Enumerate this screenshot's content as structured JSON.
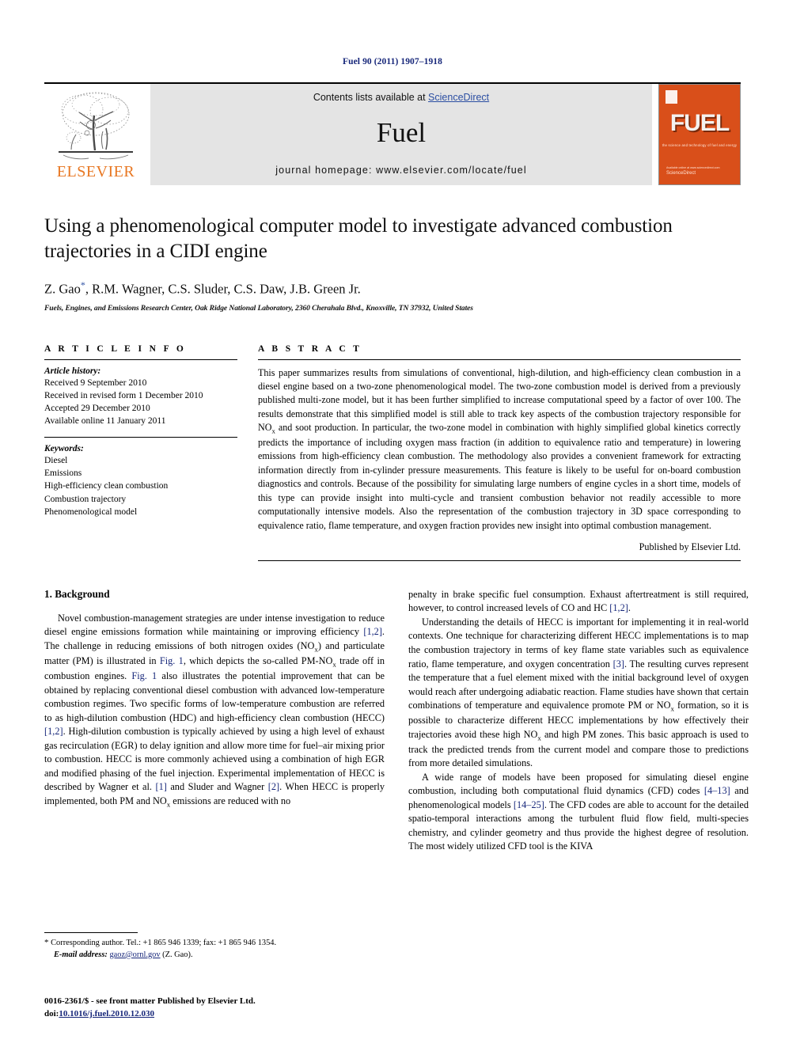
{
  "running_head": "Fuel 90 (2011) 1907–1918",
  "masthead": {
    "elsevier_wordmark": "ELSEVIER",
    "contents_prefix": "Contents lists available at ",
    "sciencedirect": "ScienceDirect",
    "journal_name": "Fuel",
    "homepage": "journal homepage: www.elsevier.com/locate/fuel",
    "cover": {
      "title": "FUEL",
      "subtitle": "the science and technology of fuel and energy",
      "footer_line1": "Available online at www.sciencedirect.com",
      "footer_line2": "ScienceDirect"
    }
  },
  "article": {
    "title": "Using a phenomenological computer model to investigate advanced combustion trajectories in a CIDI engine",
    "authors": "Z. Gao",
    "authors_rest": ", R.M. Wagner, C.S. Sluder, C.S. Daw, J.B. Green Jr.",
    "corresponding_marker": "*",
    "affiliation": "Fuels, Engines, and Emissions Research Center, Oak Ridge National Laboratory, 2360 Cherahala Blvd., Knoxville, TN 37932, United States"
  },
  "article_info": {
    "heading": "A R T I C L E    I N F O",
    "history_label": "Article history:",
    "history": [
      "Received 9 September 2010",
      "Received in revised form 1 December 2010",
      "Accepted 29 December 2010",
      "Available online 11 January 2011"
    ],
    "keywords_label": "Keywords:",
    "keywords": [
      "Diesel",
      "Emissions",
      "High-efficiency clean combustion",
      "Combustion trajectory",
      "Phenomenological model"
    ]
  },
  "abstract": {
    "heading": "A B S T R A C T",
    "text": "This paper summarizes results from simulations of conventional, high-dilution, and high-efficiency clean combustion in a diesel engine based on a two-zone phenomenological model. The two-zone combustion model is derived from a previously published multi-zone model, but it has been further simplified to increase computational speed by a factor of over 100. The results demonstrate that this simplified model is still able to track key aspects of the combustion trajectory responsible for NOx and soot production. In particular, the two-zone model in combination with highly simplified global kinetics correctly predicts the importance of including oxygen mass fraction (in addition to equivalence ratio and temperature) in lowering emissions from high-efficiency clean combustion. The methodology also provides a convenient framework for extracting information directly from in-cylinder pressure measurements. This feature is likely to be useful for on-board combustion diagnostics and controls. Because of the possibility for simulating large numbers of engine cycles in a short time, models of this type can provide insight into multi-cycle and transient combustion behavior not readily accessible to more computationally intensive models. Also the representation of the combustion trajectory in 3D space corresponding to equivalence ratio, flame temperature, and oxygen fraction provides new insight into optimal combustion management.",
    "publisher": "Published by Elsevier Ltd."
  },
  "body": {
    "section_heading": "1. Background",
    "left_paragraph_1": "Novel combustion-management strategies are under intense investigation to reduce diesel engine emissions formation while maintaining or improving efficiency [1,2]. The challenge in reducing emissions of both nitrogen oxides (NOx) and particulate matter (PM) is illustrated in Fig. 1, which depicts the so-called PM-NOx trade off in combustion engines. Fig. 1 also illustrates the potential improvement that can be obtained by replacing conventional diesel combustion with advanced low-temperature combustion regimes. Two specific forms of low-temperature combustion are referred to as high-dilution combustion (HDC) and high-efficiency clean combustion (HECC) [1,2]. High-dilution combustion is typically achieved by using a high level of exhaust gas recirculation (EGR) to delay ignition and allow more time for fuel–air mixing prior to combustion. HECC is more commonly achieved using a combination of high EGR and modified phasing of the fuel injection. Experimental implementation of HECC is described by Wagner et al. [1] and Sluder and Wagner [2]. When HECC is properly implemented, both PM and NOx emissions are reduced with no penalty in brake specific fuel consumption. Exhaust aftertreatment is still required, however, to control increased levels of CO and HC [1,2].",
    "right_paragraph_2": "Understanding the details of HECC is important for implementing it in real-world contexts. One technique for characterizing different HECC implementations is to map the combustion trajectory in terms of key flame state variables such as equivalence ratio, flame temperature, and oxygen concentration [3]. The resulting curves represent the temperature that a fuel element mixed with the initial background level of oxygen would reach after undergoing adiabatic reaction. Flame studies have shown that certain combinations of temperature and equivalence promote PM or NOx formation, so it is possible to characterize different HECC implementations by how effectively their trajectories avoid these high NOx and high PM zones. This basic approach is used to track the predicted trends from the current model and compare those to predictions from more detailed simulations.",
    "right_paragraph_3": "A wide range of models have been proposed for simulating diesel engine combustion, including both computational fluid dynamics (CFD) codes [4–13] and phenomenological models [14–25]. The CFD codes are able to account for the detailed spatio-temporal interactions among the turbulent fluid flow field, multi-species chemistry, and cylinder geometry and thus provide the highest degree of resolution. The most widely utilized CFD tool is the KIVA"
  },
  "footnote": {
    "corresponding": "Corresponding author. Tel.: +1 865 946 1339; fax: +1 865 946 1354.",
    "email_label": "E-mail address:",
    "email": "gaoz@ornl.gov",
    "email_owner": "(Z. Gao)."
  },
  "colophon": {
    "line1": "0016-2361/$ - see front matter Published by Elsevier Ltd.",
    "doi_label": "doi:",
    "doi": "10.1016/j.fuel.2010.12.030"
  },
  "colors": {
    "link_blue": "#17277a",
    "sciencedirect_blue": "#2b4ea2",
    "elsevier_orange": "#e87722",
    "cover_orange": "#d94f1a",
    "band_gray": "#e4e4e4"
  }
}
